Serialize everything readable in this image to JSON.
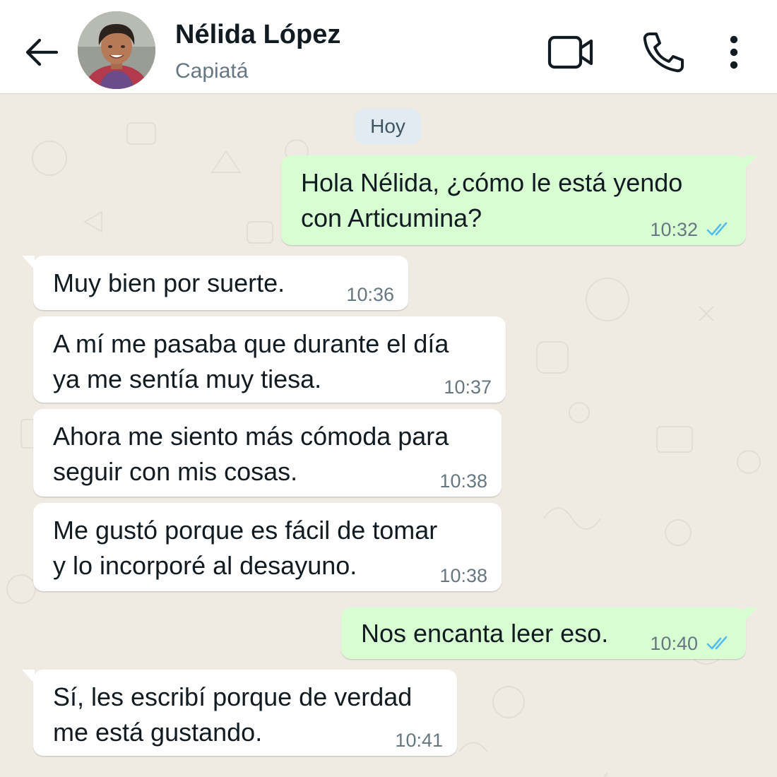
{
  "header": {
    "contact_name": "Nélida López",
    "contact_subtitle": "Capiatá",
    "icons": [
      "back-arrow-icon",
      "video-call-icon",
      "voice-call-icon",
      "more-options-icon"
    ]
  },
  "chat": {
    "date_label": "Hoy",
    "messages": [
      {
        "direction": "outgoing",
        "lines": [
          "Hola Nélida, ¿cómo le está yendo",
          "con Articumina?"
        ],
        "time": "10:32",
        "status": "read"
      },
      {
        "direction": "incoming",
        "lines": [
          "Muy bien por suerte."
        ],
        "time": "10:36"
      },
      {
        "direction": "incoming",
        "lines": [
          "A mí me pasaba que durante el día",
          "ya me sentía muy tiesa."
        ],
        "time": "10:37"
      },
      {
        "direction": "incoming",
        "lines": [
          "Ahora me siento más cómoda para",
          "seguir con mis cosas."
        ],
        "time": "10:38"
      },
      {
        "direction": "incoming",
        "lines": [
          "Me gustó porque es fácil de tomar",
          "y lo incorporé al desayuno."
        ],
        "time": "10:38"
      },
      {
        "direction": "outgoing",
        "lines": [
          "Nos encanta leer eso."
        ],
        "time": "10:40",
        "status": "read"
      },
      {
        "direction": "incoming",
        "lines": [
          "Sí, les escribí porque de verdad",
          "me está gustando."
        ],
        "time": "10:41"
      }
    ]
  },
  "colors": {
    "background": "#efeae2",
    "incoming_bubble": "#ffffff",
    "outgoing_bubble": "#d9fdd3",
    "read_ticks": "#53bdeb",
    "date_chip": "#e1ebf1"
  }
}
